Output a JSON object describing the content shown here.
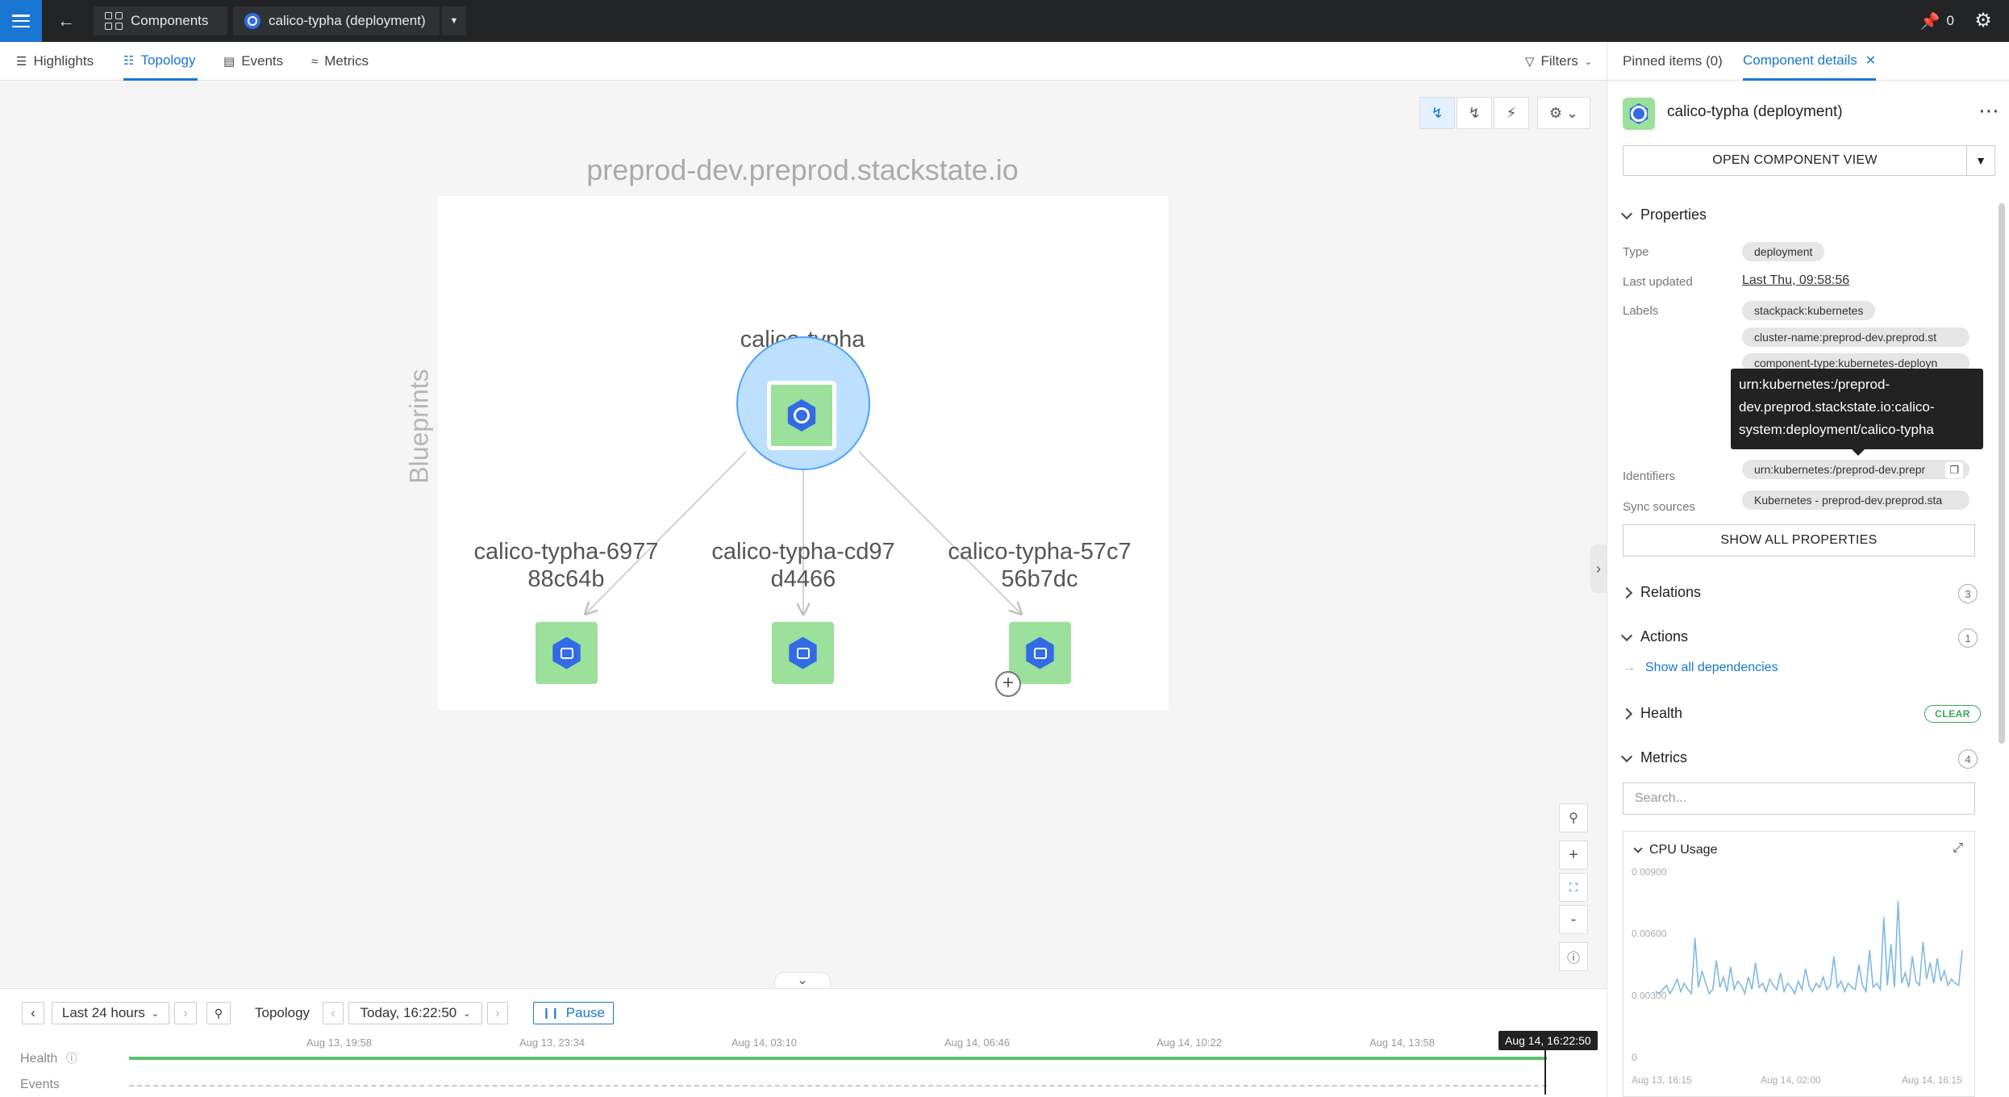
{
  "topbar": {
    "components_label": "Components",
    "deployment_tab": "calico-typha (deployment)",
    "pinned_count": "0"
  },
  "subnav": {
    "tabs": [
      {
        "label": "Highlights"
      },
      {
        "label": "Topology"
      },
      {
        "label": "Events"
      },
      {
        "label": "Metrics"
      }
    ],
    "filters_label": "Filters"
  },
  "topology": {
    "cluster_title": "preprod-dev.preprod.stackstate.io",
    "side_label": "Blueprints",
    "root": {
      "label": "calico-typha"
    },
    "children": [
      {
        "label_line1": "calico-typha-6977",
        "label_line2": "88c64b"
      },
      {
        "label_line1": "calico-typha-cd97",
        "label_line2": "d4466"
      },
      {
        "label_line1": "calico-typha-57c7",
        "label_line2": "56b7dc"
      }
    ]
  },
  "timeline": {
    "range_label": "Last 24 hours",
    "mode_label": "Topology",
    "time_label": "Today, 16:22:50",
    "pause_label": "Pause",
    "ticks": [
      "Aug 13, 19:58",
      "Aug 13, 23:34",
      "Aug 14, 03:10",
      "Aug 14, 06:46",
      "Aug 14, 10:22",
      "Aug 14, 13:58"
    ],
    "current": "Aug 14, 16:22:50",
    "health_label": "Health",
    "events_label": "Events"
  },
  "panel": {
    "tabs": {
      "pinned": "Pinned items (0)",
      "details": "Component details"
    },
    "title": "calico-typha (deployment)",
    "open_view": "OPEN COMPONENT VIEW",
    "properties_title": "Properties",
    "type_label": "Type",
    "type_value": "deployment",
    "updated_label": "Last updated",
    "updated_value": "Last Thu, 09:58:56",
    "labels_label": "Labels",
    "labels": [
      "stackpack:kubernetes",
      "cluster-name:preprod-dev.preprod.st",
      "component-type:kubernetes-deployn"
    ],
    "tooltip": "urn:kubernetes:/preprod-dev.preprod.stackstate.io:calico-system:deployment/calico-typha",
    "identifiers_label": "Identifiers",
    "identifiers_value": "urn:kubernetes:/preprod-dev.prepr",
    "sync_label": "Sync sources",
    "sync_value": "Kubernetes - preprod-dev.preprod.sta",
    "show_all": "SHOW ALL PROPERTIES",
    "relations_title": "Relations",
    "relations_count": "3",
    "actions_title": "Actions",
    "actions_count": "1",
    "show_deps": "Show all dependencies",
    "health_title": "Health",
    "health_badge": "CLEAR",
    "metrics_title": "Metrics",
    "metrics_count": "4",
    "search_placeholder": "Search...",
    "cpu_title": "CPU Usage"
  },
  "chart_data": {
    "type": "line",
    "title": "CPU Usage",
    "y_ticks": [
      "0.00900",
      "0.00600",
      "0.00300",
      "0"
    ],
    "x_ticks": [
      "Aug 13, 16:15",
      "Aug 14, 02:00",
      "Aug 14, 16:15"
    ],
    "ylim": [
      0,
      0.009
    ],
    "color": "#7fb8e6",
    "values": [
      0.0032,
      0.0031,
      0.0033,
      0.0035,
      0.0031,
      0.0034,
      0.0038,
      0.0032,
      0.0036,
      0.0033,
      0.0031,
      0.0058,
      0.0034,
      0.0042,
      0.0036,
      0.0031,
      0.0033,
      0.0047,
      0.0034,
      0.0039,
      0.0032,
      0.0044,
      0.0033,
      0.0037,
      0.0035,
      0.0031,
      0.0039,
      0.0033,
      0.0046,
      0.0034,
      0.0036,
      0.0032,
      0.0038,
      0.0035,
      0.0033,
      0.0041,
      0.0032,
      0.0036,
      0.0034,
      0.0031,
      0.0037,
      0.0033,
      0.0043,
      0.0035,
      0.0032,
      0.0036,
      0.0034,
      0.0039,
      0.0033,
      0.0035,
      0.0049,
      0.0034,
      0.0037,
      0.0032,
      0.0036,
      0.0034,
      0.0033,
      0.0045,
      0.0035,
      0.0032,
      0.0052,
      0.0034,
      0.0036,
      0.0033,
      0.0068,
      0.0035,
      0.0055,
      0.0034,
      0.0076,
      0.0036,
      0.0041,
      0.0034,
      0.0049,
      0.0037,
      0.0035,
      0.0056,
      0.0038,
      0.0046,
      0.0036,
      0.0048,
      0.0037,
      0.0042,
      0.0035,
      0.0038,
      0.0036,
      0.0035,
      0.0052
    ]
  }
}
